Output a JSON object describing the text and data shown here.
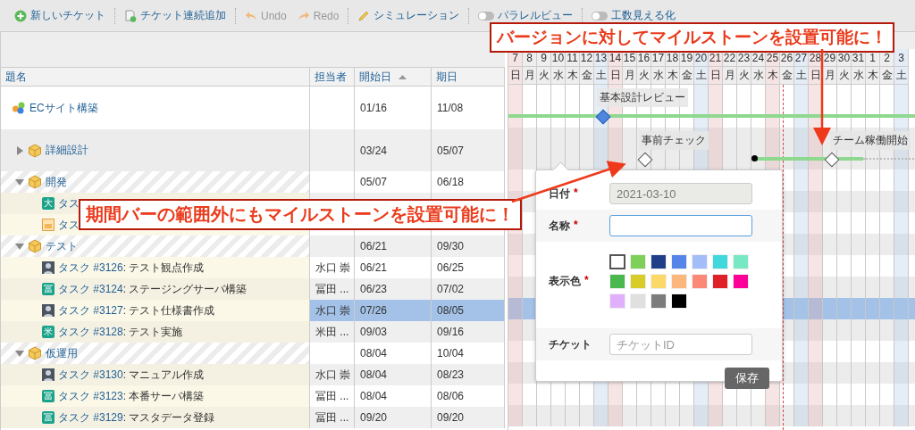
{
  "toolbar": [
    {
      "kind": "new",
      "label": "新しいチケット",
      "disabled": false
    },
    {
      "kind": "bulk",
      "label": "チケット連続追加",
      "disabled": false
    },
    {
      "kind": "undo",
      "label": "Undo",
      "disabled": true
    },
    {
      "kind": "redo",
      "label": "Redo",
      "disabled": true
    },
    {
      "kind": "simulation",
      "label": "シミュレーション",
      "disabled": false
    },
    {
      "kind": "toggle",
      "label": "パラレルビュー",
      "disabled": false,
      "on": false
    },
    {
      "kind": "toggle",
      "label": "工数見える化",
      "disabled": false,
      "on": false
    }
  ],
  "columns": [
    {
      "label": "題名",
      "sorted": false
    },
    {
      "label": "担当者",
      "sorted": false
    },
    {
      "label": "開始日",
      "sorted": true
    },
    {
      "label": "期日",
      "sorted": false
    }
  ],
  "rows": [
    {
      "kind": "project",
      "title": "ECサイト構築",
      "start": "01/16",
      "due": "11/08",
      "selected": false,
      "milestones": [
        {
          "label": "基本設計レビュー",
          "filled": true
        }
      ],
      "children": [
        {
          "kind": "version",
          "title": "詳細設計",
          "start": "03/24",
          "due": "05/07",
          "selected": false,
          "expanded": false,
          "milestones": [
            {
              "label": "事前チェック",
              "filled": false
            },
            {
              "label": "チーム稼働開始",
              "filled": false
            }
          ]
        },
        {
          "kind": "version",
          "title": "開発",
          "start": "05/07",
          "due": "06/18",
          "selected": false,
          "expanded": true,
          "children": [
            {
              "kind": "task",
              "avatar": {
                "kind": "letter",
                "letter": "大"
              },
              "link": "タス",
              "selected": false
            },
            {
              "kind": "task",
              "avatar": {
                "kind": "ticket"
              },
              "link": "タス",
              "selected": false
            }
          ]
        },
        {
          "kind": "version",
          "title": "テスト",
          "start": "06/21",
          "due": "09/30",
          "selected": false,
          "expanded": true,
          "children": [
            {
              "kind": "task",
              "avatar": {
                "kind": "photo"
              },
              "link": "タスク #3126",
              "subject": ": テスト観点作成",
              "assignee": "水口 崇",
              "start": "06/21",
              "due": "06/25",
              "selected": false
            },
            {
              "kind": "task",
              "avatar": {
                "kind": "letter",
                "letter": "冨"
              },
              "link": "タスク #3124",
              "subject": ": ステージングサーバ構築",
              "assignee": "冨田 ...",
              "start": "06/23",
              "due": "07/02",
              "selected": false
            },
            {
              "kind": "task",
              "avatar": {
                "kind": "photo"
              },
              "link": "タスク #3127",
              "subject": ": テスト仕様書作成",
              "assignee": "水口 崇",
              "start": "07/26",
              "due": "08/05",
              "selected": true
            },
            {
              "kind": "task",
              "avatar": {
                "kind": "letter",
                "letter": "米"
              },
              "link": "タスク #3128",
              "subject": ": テスト実施",
              "assignee": "米田 ...",
              "start": "09/03",
              "due": "09/16",
              "selected": false
            }
          ]
        },
        {
          "kind": "version",
          "title": "仮運用",
          "start": "08/04",
          "due": "10/04",
          "selected": false,
          "expanded": true,
          "children": [
            {
              "kind": "task",
              "avatar": {
                "kind": "photo"
              },
              "link": "タスク #3130",
              "subject": ": マニュアル作成",
              "assignee": "水口 崇",
              "start": "08/04",
              "due": "08/23",
              "selected": false
            },
            {
              "kind": "task",
              "avatar": {
                "kind": "letter",
                "letter": "冨"
              },
              "link": "タスク #3123",
              "subject": ": 本番サーバ構築",
              "assignee": "冨田 ...",
              "start": "08/04",
              "due": "08/06",
              "selected": false
            },
            {
              "kind": "task",
              "avatar": {
                "kind": "letter",
                "letter": "冨"
              },
              "link": "タスク #3129",
              "subject": ": マスタデータ登録",
              "assignee": "冨田 ...",
              "start": "09/20",
              "due": "09/20",
              "selected": false
            }
          ]
        }
      ]
    }
  ],
  "days": [
    {
      "day": "7",
      "weekday": "日",
      "kind": "sunday"
    },
    {
      "day": "8",
      "weekday": "月",
      "kind": "weekday"
    },
    {
      "day": "9",
      "weekday": "火",
      "kind": "weekday"
    },
    {
      "day": "10",
      "weekday": "水",
      "kind": "weekday"
    },
    {
      "day": "11",
      "weekday": "木",
      "kind": "weekday"
    },
    {
      "day": "12",
      "weekday": "金",
      "kind": "weekday"
    },
    {
      "day": "13",
      "weekday": "土",
      "kind": "saturday"
    },
    {
      "day": "14",
      "weekday": "日",
      "kind": "sunday"
    },
    {
      "day": "15",
      "weekday": "月",
      "kind": "weekday"
    },
    {
      "day": "16",
      "weekday": "火",
      "kind": "weekday"
    },
    {
      "day": "17",
      "weekday": "水",
      "kind": "weekday"
    },
    {
      "day": "18",
      "weekday": "木",
      "kind": "weekday"
    },
    {
      "day": "19",
      "weekday": "金",
      "kind": "weekday"
    },
    {
      "day": "20",
      "weekday": "土",
      "kind": "saturday"
    },
    {
      "day": "21",
      "weekday": "日",
      "kind": "sunday"
    },
    {
      "day": "22",
      "weekday": "月",
      "kind": "weekday"
    },
    {
      "day": "23",
      "weekday": "火",
      "kind": "weekday"
    },
    {
      "day": "24",
      "weekday": "水",
      "kind": "weekday"
    },
    {
      "day": "25",
      "weekday": "木",
      "kind": "holiday"
    },
    {
      "day": "26",
      "weekday": "金",
      "kind": "weekday"
    },
    {
      "day": "27",
      "weekday": "土",
      "kind": "saturday"
    },
    {
      "day": "28",
      "weekday": "日",
      "kind": "sunday"
    },
    {
      "day": "29",
      "weekday": "月",
      "kind": "weekday"
    },
    {
      "day": "30",
      "weekday": "火",
      "kind": "weekday"
    },
    {
      "day": "31",
      "weekday": "水",
      "kind": "weekday"
    },
    {
      "day": "1",
      "weekday": "木",
      "kind": "weekday"
    },
    {
      "day": "2",
      "weekday": "金",
      "kind": "weekday"
    },
    {
      "day": "3",
      "weekday": "土",
      "kind": "saturday"
    }
  ],
  "popover": {
    "fields": [
      {
        "kind": "input",
        "label": "日付",
        "required_mark": "*",
        "value": "2021-03-10",
        "disabled": true,
        "focused": false
      },
      {
        "kind": "input",
        "label": "名称",
        "required_mark": "*",
        "disabled": false,
        "focused": true
      },
      {
        "kind": "colors",
        "label": "表示色",
        "required_mark": "*",
        "colors": [
          {
            "color": "#ffffff",
            "selected": true
          },
          {
            "color": "#7ed058",
            "selected": false
          },
          {
            "color": "#1f3f88",
            "selected": false
          },
          {
            "color": "#5585e8",
            "selected": false
          },
          {
            "color": "#a3bdf8",
            "selected": false
          },
          {
            "color": "#40d8dc",
            "selected": false
          },
          {
            "color": "#78e8c4",
            "selected": false
          },
          {
            "color": "#4ab84e",
            "selected": false
          },
          {
            "color": "#d8cc28",
            "selected": false
          },
          {
            "color": "#fcd868",
            "selected": false
          },
          {
            "color": "#fcb87c",
            "selected": false
          },
          {
            "color": "#fc8878",
            "selected": false
          },
          {
            "color": "#e02028",
            "selected": false
          },
          {
            "color": "#fc0098",
            "selected": false
          },
          {
            "color": "#e0b0fc",
            "selected": false
          },
          {
            "color": "#e0e0e0",
            "selected": false
          },
          {
            "color": "#7c7c7c",
            "selected": false
          },
          {
            "color": "#000000",
            "selected": false
          }
        ]
      },
      {
        "kind": "input",
        "label": "チケット",
        "placeholder": "チケットID",
        "disabled": false,
        "focused": false
      }
    ],
    "save": "保存"
  },
  "callouts": [
    {
      "text": "バージョンに対してマイルストーンを設置可能に！"
    },
    {
      "text": "期間バーの範囲外にもマイルストーンを設置可能に！"
    }
  ]
}
